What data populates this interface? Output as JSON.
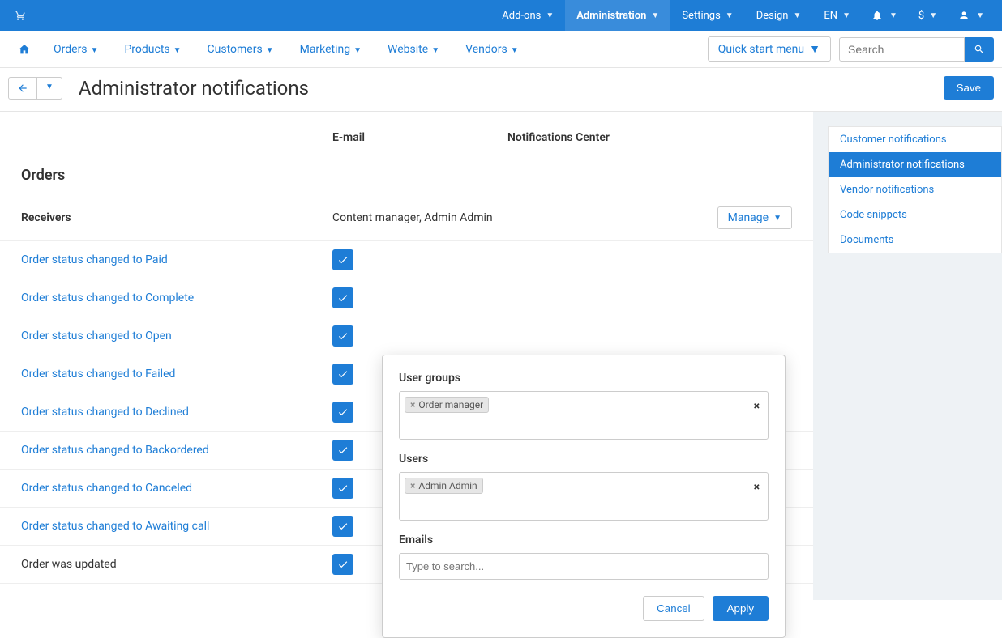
{
  "topbar": {
    "addons": "Add-ons",
    "administration": "Administration",
    "settings": "Settings",
    "design": "Design",
    "lang": "EN",
    "currency": "$"
  },
  "nav": {
    "orders": "Orders",
    "products": "Products",
    "customers": "Customers",
    "marketing": "Marketing",
    "website": "Website",
    "vendors": "Vendors",
    "quickstart": "Quick start menu",
    "search_placeholder": "Search"
  },
  "page": {
    "title": "Administrator notifications",
    "save": "Save"
  },
  "columns": {
    "email": "E-mail",
    "notif_center": "Notifications Center"
  },
  "section": {
    "orders": "Orders",
    "receivers_label": "Receivers",
    "receivers_value": "Content manager, Admin Admin",
    "manage": "Manage"
  },
  "rows": [
    {
      "label": "Order status changed to Paid",
      "link": true
    },
    {
      "label": "Order status changed to Complete",
      "link": true
    },
    {
      "label": "Order status changed to Open",
      "link": true
    },
    {
      "label": "Order status changed to Failed",
      "link": true
    },
    {
      "label": "Order status changed to Declined",
      "link": true
    },
    {
      "label": "Order status changed to Backordered",
      "link": true
    },
    {
      "label": "Order status changed to Canceled",
      "link": true
    },
    {
      "label": "Order status changed to Awaiting call",
      "link": true
    },
    {
      "label": "Order was updated",
      "link": false
    }
  ],
  "popover": {
    "user_groups_label": "User groups",
    "user_groups_tag": "Order manager",
    "users_label": "Users",
    "users_tag": "Admin Admin",
    "emails_label": "Emails",
    "emails_placeholder": "Type to search...",
    "cancel": "Cancel",
    "apply": "Apply"
  },
  "sidebar": {
    "items": [
      {
        "label": "Customer notifications",
        "active": false
      },
      {
        "label": "Administrator notifications",
        "active": true
      },
      {
        "label": "Vendor notifications",
        "active": false
      },
      {
        "label": "Code snippets",
        "active": false
      },
      {
        "label": "Documents",
        "active": false
      }
    ]
  }
}
